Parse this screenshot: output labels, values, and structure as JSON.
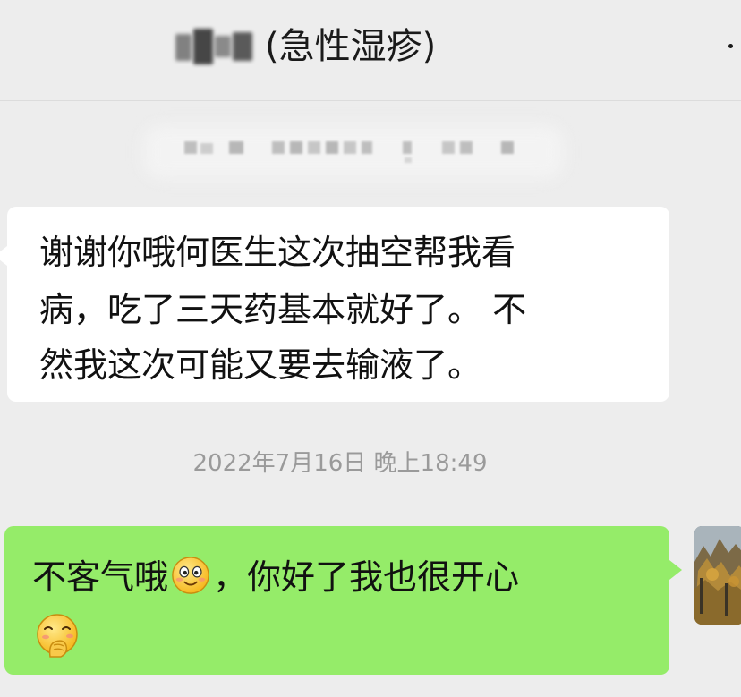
{
  "header": {
    "title": "(急性湿疹)",
    "more_icon": "more-dots-icon"
  },
  "messages": [
    {
      "side": "received",
      "lines": [
        "谢谢你哦何医生这次抽空帮我看",
        "病，吃了三天药基本就好了。 不",
        "然我这次可能又要去输液了。"
      ]
    },
    {
      "side": "sent",
      "text_before_emoji": "不客气哦",
      "text_after_emoji": "，你好了我也很开心",
      "emoji_inline": "smile-emoji",
      "emoji_line2": "hehe-emoji"
    }
  ],
  "timestamp": "2022年7月16日 晚上18:49",
  "colors": {
    "background": "#ededed",
    "received_bubble": "#ffffff",
    "sent_bubble": "#95ec69",
    "timestamp_text": "#9a9a9a"
  }
}
